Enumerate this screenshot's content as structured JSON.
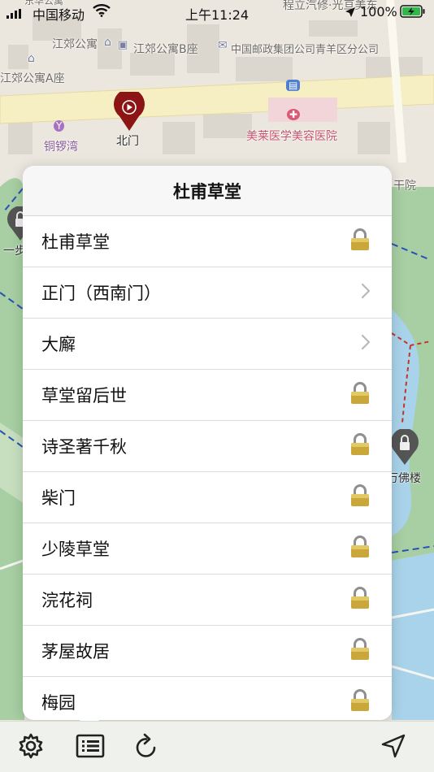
{
  "status_bar": {
    "carrier": "中国移动",
    "time": "上午11:24",
    "battery": "100%"
  },
  "map_labels": {
    "top_clip_left": "东华公寓",
    "top_clip_right": "程立汽修·光亘美东",
    "jiangjiao": "江郊公寓",
    "jiangjiao_b": "江郊公寓B座",
    "china_post": "中国邮政集团公司青羊区分公司",
    "jiangjiao_a": "江郊公寓A座",
    "tongluowan": "铜锣湾",
    "north_gate": "北门",
    "meilai": "美莱医学美容医院",
    "ganyuan": "干院",
    "wanfo": "万佛楼",
    "left_partial": "一步"
  },
  "popover": {
    "title": "杜甫草堂",
    "items": [
      {
        "label": "杜甫草堂",
        "icon": "lock-icon"
      },
      {
        "label": "正门（西南门）",
        "icon": "chevron-right-icon"
      },
      {
        "label": "大廨",
        "icon": "chevron-right-icon"
      },
      {
        "label": "草堂留后世",
        "icon": "lock-icon"
      },
      {
        "label": "诗圣著千秋",
        "icon": "lock-icon"
      },
      {
        "label": "柴门",
        "icon": "lock-icon"
      },
      {
        "label": "少陵草堂",
        "icon": "lock-icon"
      },
      {
        "label": "浣花祠",
        "icon": "lock-icon"
      },
      {
        "label": "茅屋故居",
        "icon": "lock-icon"
      },
      {
        "label": "梅园",
        "icon": "lock-icon"
      }
    ]
  },
  "toolbar": {
    "icons": [
      "gear-icon",
      "list-icon",
      "refresh-icon",
      "location-arrow-icon"
    ]
  },
  "colors": {
    "park_green": "#a7cfa3",
    "water_blue": "#a9d3ea",
    "road_yellow": "#f7efc4",
    "pin_red": "#8c1414",
    "lock_gold": "#c9a73a"
  }
}
